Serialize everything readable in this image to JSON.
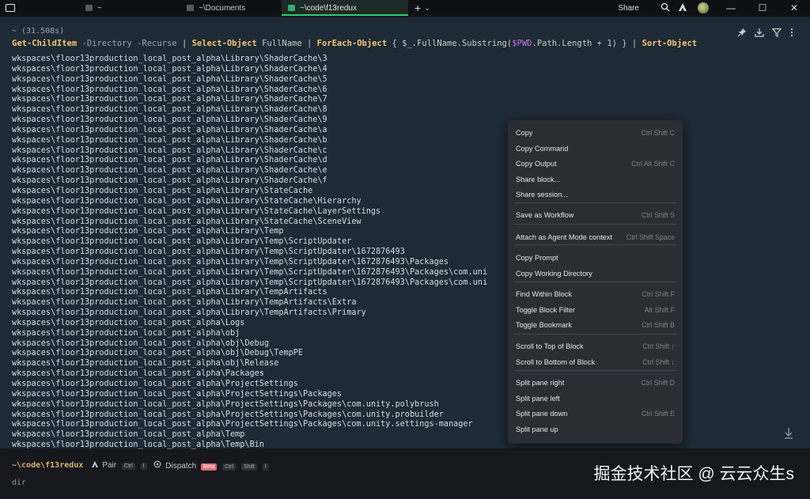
{
  "titlebar": {
    "tabs": [
      {
        "label": "~"
      },
      {
        "label": "~\\Documents"
      },
      {
        "label": "~\\code\\f13redux"
      }
    ],
    "new_tab": "+",
    "new_tab_caret": "⌄",
    "share_label": "Share",
    "minimize": "—",
    "maximize": "☐",
    "close": "✕"
  },
  "block": {
    "duration": "~ (31.508s)",
    "command": {
      "p1": "Get-ChildItem",
      "p2": " -Directory -Recurse",
      "p3": " | ",
      "p4": "Select-Object",
      "p5": " FullName | ",
      "p6": "ForEach-Object",
      "p7": " { $_.FullName.Substring(",
      "p8": "$PWD",
      "p9": ".Path.Length + 1) } | ",
      "p10": "Sort-Object"
    },
    "output_lines": [
      "wkspaces\\floor13production_local_post_alpha\\Library\\ShaderCache\\3",
      "wkspaces\\floor13production_local_post_alpha\\Library\\ShaderCache\\4",
      "wkspaces\\floor13production_local_post_alpha\\Library\\ShaderCache\\5",
      "wkspaces\\floor13production_local_post_alpha\\Library\\ShaderCache\\6",
      "wkspaces\\floor13production_local_post_alpha\\Library\\ShaderCache\\7",
      "wkspaces\\floor13production_local_post_alpha\\Library\\ShaderCache\\8",
      "wkspaces\\floor13production_local_post_alpha\\Library\\ShaderCache\\9",
      "wkspaces\\floor13production_local_post_alpha\\Library\\ShaderCache\\a",
      "wkspaces\\floor13production_local_post_alpha\\Library\\ShaderCache\\b",
      "wkspaces\\floor13production_local_post_alpha\\Library\\ShaderCache\\c",
      "wkspaces\\floor13production_local_post_alpha\\Library\\ShaderCache\\d",
      "wkspaces\\floor13production_local_post_alpha\\Library\\ShaderCache\\e",
      "wkspaces\\floor13production_local_post_alpha\\Library\\ShaderCache\\f",
      "wkspaces\\floor13production_local_post_alpha\\Library\\StateCache",
      "wkspaces\\floor13production_local_post_alpha\\Library\\StateCache\\Hierarchy",
      "wkspaces\\floor13production_local_post_alpha\\Library\\StateCache\\LayerSettings",
      "wkspaces\\floor13production_local_post_alpha\\Library\\StateCache\\SceneView",
      "wkspaces\\floor13production_local_post_alpha\\Library\\Temp",
      "wkspaces\\floor13production_local_post_alpha\\Library\\Temp\\ScriptUpdater",
      "wkspaces\\floor13production_local_post_alpha\\Library\\Temp\\ScriptUpdater\\1672876493",
      "wkspaces\\floor13production_local_post_alpha\\Library\\Temp\\ScriptUpdater\\1672876493\\Packages",
      "wkspaces\\floor13production_local_post_alpha\\Library\\Temp\\ScriptUpdater\\1672876493\\Packages\\com.uni",
      "wkspaces\\floor13production_local_post_alpha\\Library\\Temp\\ScriptUpdater\\1672876493\\Packages\\com.uni",
      "wkspaces\\floor13production_local_post_alpha\\Library\\TempArtifacts",
      "wkspaces\\floor13production_local_post_alpha\\Library\\TempArtifacts\\Extra",
      "wkspaces\\floor13production_local_post_alpha\\Library\\TempArtifacts\\Primary",
      "wkspaces\\floor13production_local_post_alpha\\Logs",
      "wkspaces\\floor13production_local_post_alpha\\obj",
      "wkspaces\\floor13production_local_post_alpha\\obj\\Debug",
      "wkspaces\\floor13production_local_post_alpha\\obj\\Debug\\TempPE",
      "wkspaces\\floor13production_local_post_alpha\\obj\\Release",
      "wkspaces\\floor13production_local_post_alpha\\Packages",
      "wkspaces\\floor13production_local_post_alpha\\ProjectSettings",
      "wkspaces\\floor13production_local_post_alpha\\ProjectSettings\\Packages",
      "wkspaces\\floor13production_local_post_alpha\\ProjectSettings\\Packages\\com.unity.polybrush",
      "wkspaces\\floor13production_local_post_alpha\\ProjectSettings\\Packages\\com.unity.probuilder",
      "wkspaces\\floor13production_local_post_alpha\\ProjectSettings\\Packages\\com.unity.settings-manager",
      "wkspaces\\floor13production_local_post_alpha\\Temp",
      "wkspaces\\floor13production_local_post_alpha\\Temp\\Bin"
    ]
  },
  "context_menu": {
    "items": [
      {
        "label": "Copy",
        "shortcut": "Ctrl Shift C"
      },
      {
        "label": "Copy Command",
        "shortcut": ""
      },
      {
        "label": "Copy Output",
        "shortcut": "Ctrl Alt Shift C"
      },
      {
        "label": "Share block...",
        "shortcut": ""
      },
      {
        "label": "Share session...",
        "shortcut": ""
      },
      {
        "label": "Save as Workflow",
        "shortcut": "Ctrl Shift S"
      },
      {
        "label": "Attach as Agent Mode context",
        "shortcut": "Ctrl Shift Space"
      },
      {
        "label": "Copy Prompt",
        "shortcut": ""
      },
      {
        "label": "Copy Working Directory",
        "shortcut": ""
      },
      {
        "label": "Find Within Block",
        "shortcut": "Ctrl Shift F"
      },
      {
        "label": "Toggle Block Filter",
        "shortcut": "Alt Shift F"
      },
      {
        "label": "Toggle Bookmark",
        "shortcut": "Ctrl Shift B"
      },
      {
        "label": "Scroll to Top of Block",
        "shortcut": "Ctrl Shift ↑"
      },
      {
        "label": "Scroll to Bottom of Block",
        "shortcut": "Ctrl Shift ↓"
      },
      {
        "label": "Split pane right",
        "shortcut": "Ctrl Shift D"
      },
      {
        "label": "Split pane left",
        "shortcut": ""
      },
      {
        "label": "Split pane down",
        "shortcut": "Ctrl Shift E"
      },
      {
        "label": "Split pane up",
        "shortcut": ""
      }
    ]
  },
  "input": {
    "cwd": "~\\code\\f13redux",
    "pair_label": "Pair",
    "pair_keys": [
      "Ctrl",
      "I"
    ],
    "dispatch_label": "Dispatch",
    "dispatch_badge": "Beta",
    "dispatch_keys": [
      "Ctrl",
      "Shift",
      "I"
    ],
    "text": "dir"
  },
  "watermark": "掘金技术社区 @ 云云众生s",
  "colors": {
    "accent_tab": "#2ecc71",
    "command_keyword": "#f0c674",
    "variable": "#c678dd",
    "cwd": "#e0b070",
    "beta_badge": "#e06c75"
  }
}
